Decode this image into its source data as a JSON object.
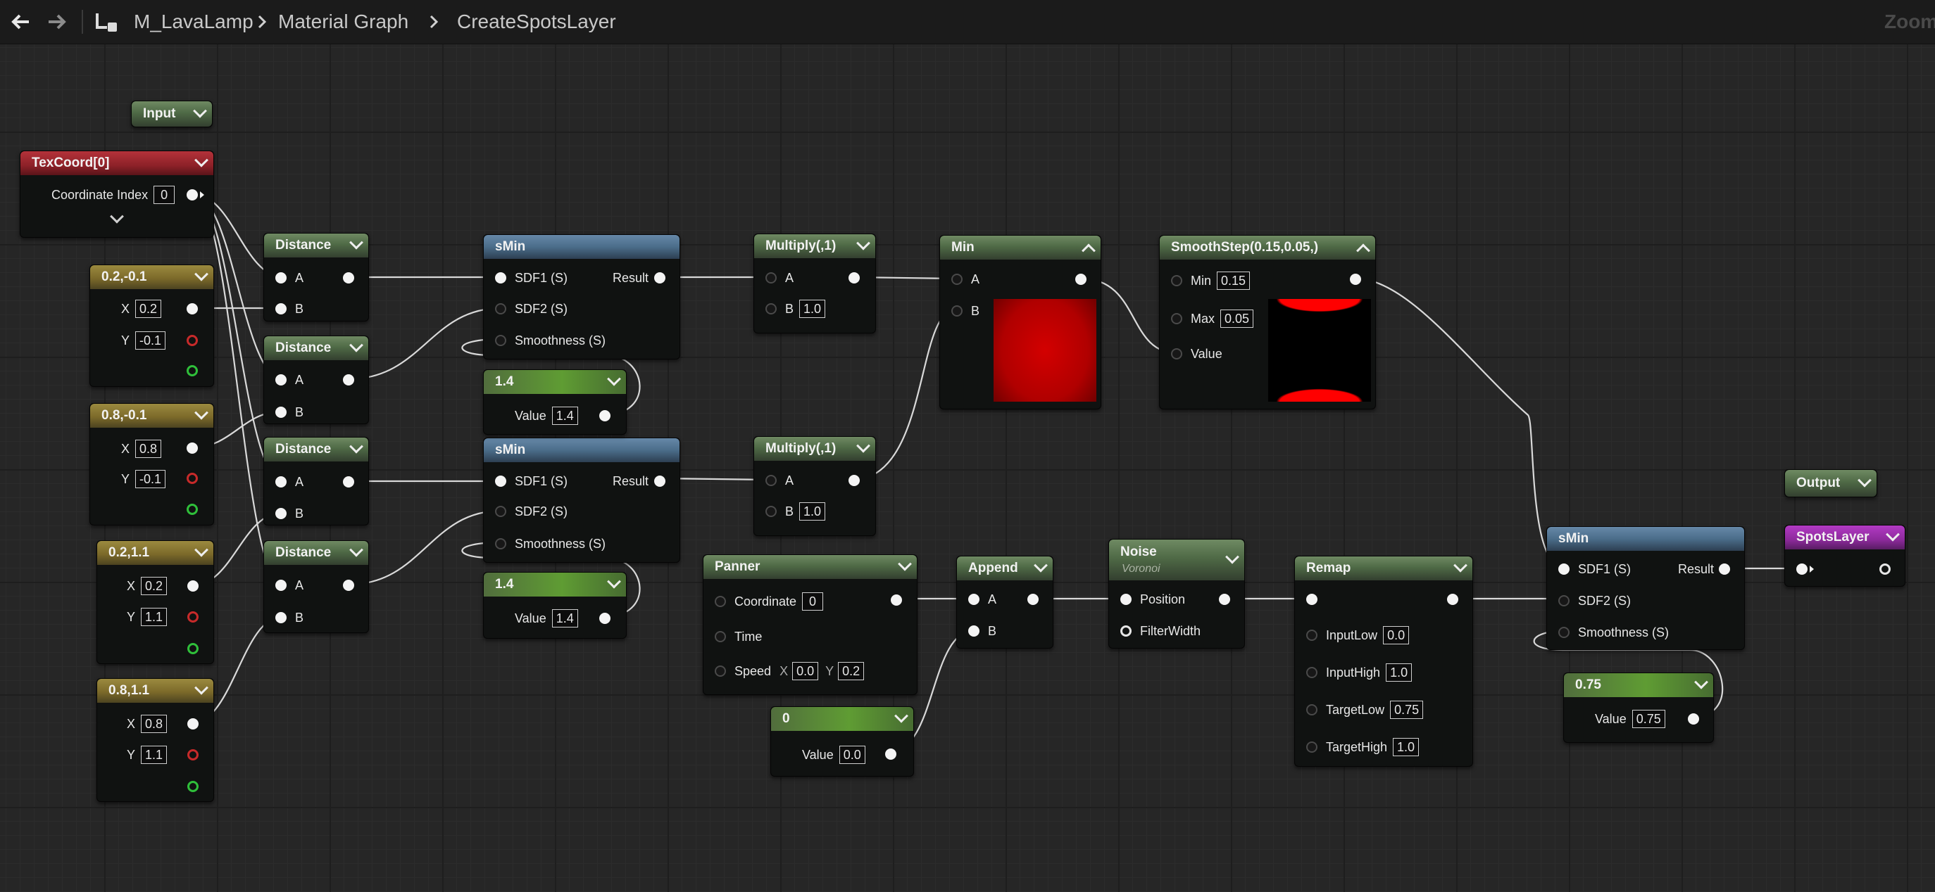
{
  "topbar": {
    "back_icon": "arrow-left-icon",
    "forward_icon": "arrow-right-icon",
    "hierarchy_icon": "hierarchy-icon",
    "asset": "M_LavaLamp",
    "graph": "Material Graph",
    "function": "CreateSpotsLayer",
    "zoom": "Zoom"
  },
  "colors": {
    "accent_red": "#c72a2a",
    "accent_green": "#2fbf3a",
    "preview_red": "#ff0000"
  },
  "nodes": {
    "input": {
      "title": "Input"
    },
    "texcoord": {
      "title": "TexCoord[0]",
      "coord_label": "Coordinate Index",
      "coord_value": "0"
    },
    "c1": {
      "title": "0.2,-0.1",
      "x_label": "X",
      "x": "0.2",
      "y_label": "Y",
      "y": "-0.1"
    },
    "c2": {
      "title": "0.8,-0.1",
      "x_label": "X",
      "x": "0.8",
      "y_label": "Y",
      "y": "-0.1"
    },
    "c3": {
      "title": "0.2,1.1",
      "x_label": "X",
      "x": "0.2",
      "y_label": "Y",
      "y": "1.1"
    },
    "c4": {
      "title": "0.8,1.1",
      "x_label": "X",
      "x": "0.8",
      "y_label": "Y",
      "y": "1.1"
    },
    "d1": {
      "title": "Distance",
      "a": "A",
      "b": "B"
    },
    "d2": {
      "title": "Distance",
      "a": "A",
      "b": "B"
    },
    "d3": {
      "title": "Distance",
      "a": "A",
      "b": "B"
    },
    "d4": {
      "title": "Distance",
      "a": "A",
      "b": "B"
    },
    "smin1": {
      "title": "sMin",
      "sdf1": "SDF1 (S)",
      "sdf2": "SDF2 (S)",
      "smooth": "Smoothness (S)",
      "result": "Result"
    },
    "smin2": {
      "title": "sMin",
      "sdf1": "SDF1 (S)",
      "sdf2": "SDF2 (S)",
      "smooth": "Smoothness (S)",
      "result": "Result"
    },
    "k1": {
      "title": "1.4",
      "label": "Value",
      "value": "1.4"
    },
    "k2": {
      "title": "1.4",
      "label": "Value",
      "value": "1.4"
    },
    "mul1": {
      "title": "Multiply(,1)",
      "a": "A",
      "b": "B",
      "b_value": "1.0"
    },
    "mul2": {
      "title": "Multiply(,1)",
      "a": "A",
      "b": "B",
      "b_value": "1.0"
    },
    "min": {
      "title": "Min",
      "a": "A",
      "b": "B"
    },
    "smoothstep": {
      "title": "SmoothStep(0.15,0.05,)",
      "min_label": "Min",
      "min_value": "0.15",
      "max_label": "Max",
      "max_value": "0.05",
      "value_label": "Value"
    },
    "panner": {
      "title": "Panner",
      "coord_label": "Coordinate",
      "coord_value": "0",
      "time_label": "Time",
      "speed_label": "Speed",
      "sx_label": "X",
      "sx": "0.0",
      "sy_label": "Y",
      "sy": "0.2"
    },
    "zero": {
      "title": "0",
      "label": "Value",
      "value": "0.0"
    },
    "append": {
      "title": "Append",
      "a": "A",
      "b": "B"
    },
    "noise": {
      "title": "Noise",
      "subtitle": "Voronoi",
      "position": "Position",
      "filterwidth": "FilterWidth"
    },
    "remap": {
      "title": "Remap",
      "il_label": "InputLow",
      "il": "0.0",
      "ih_label": "InputHigh",
      "ih": "1.0",
      "tl_label": "TargetLow",
      "tl": "0.75",
      "th_label": "TargetHigh",
      "th": "1.0"
    },
    "smin3": {
      "title": "sMin",
      "sdf1": "SDF1 (S)",
      "sdf2": "SDF2 (S)",
      "smooth": "Smoothness (S)",
      "result": "Result"
    },
    "k3": {
      "title": "0.75",
      "label": "Value",
      "value": "0.75"
    },
    "output": {
      "title": "Output"
    },
    "spots": {
      "title": "SpotsLayer"
    }
  }
}
